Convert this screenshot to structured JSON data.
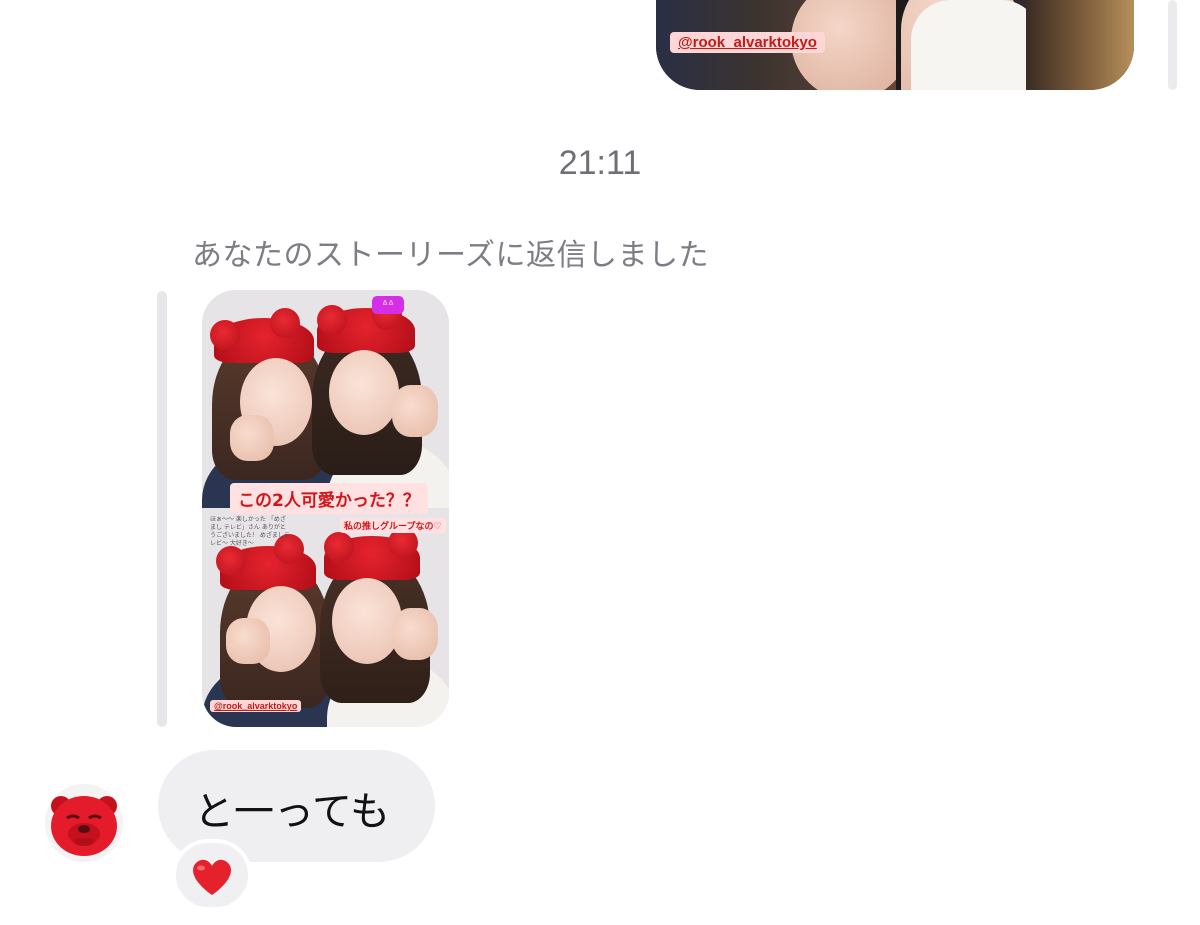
{
  "previous_message": {
    "story_tag": "@rook_alvarktokyo"
  },
  "timestamp": "21:11",
  "reply_caption": "あなたのストーリーズに返信しました",
  "story": {
    "question_sticker": "この2人可愛かった？？",
    "oshi_text": "私の推しグループなの♡",
    "note_text": "ほぁ〜〜 楽しかった 「めざまし テレビ」さん ありがとうございました！ めざましテレビ〜 大好き〜",
    "tag": "@rook_alvarktokyo",
    "app_badge_icon": "cat-icon"
  },
  "message": {
    "text": "と一っても",
    "reaction_emoji": "❤️",
    "reaction_color": "#e5212b"
  },
  "avatar": {
    "icon": "red-bear-icon",
    "color": "#e31b2a"
  }
}
